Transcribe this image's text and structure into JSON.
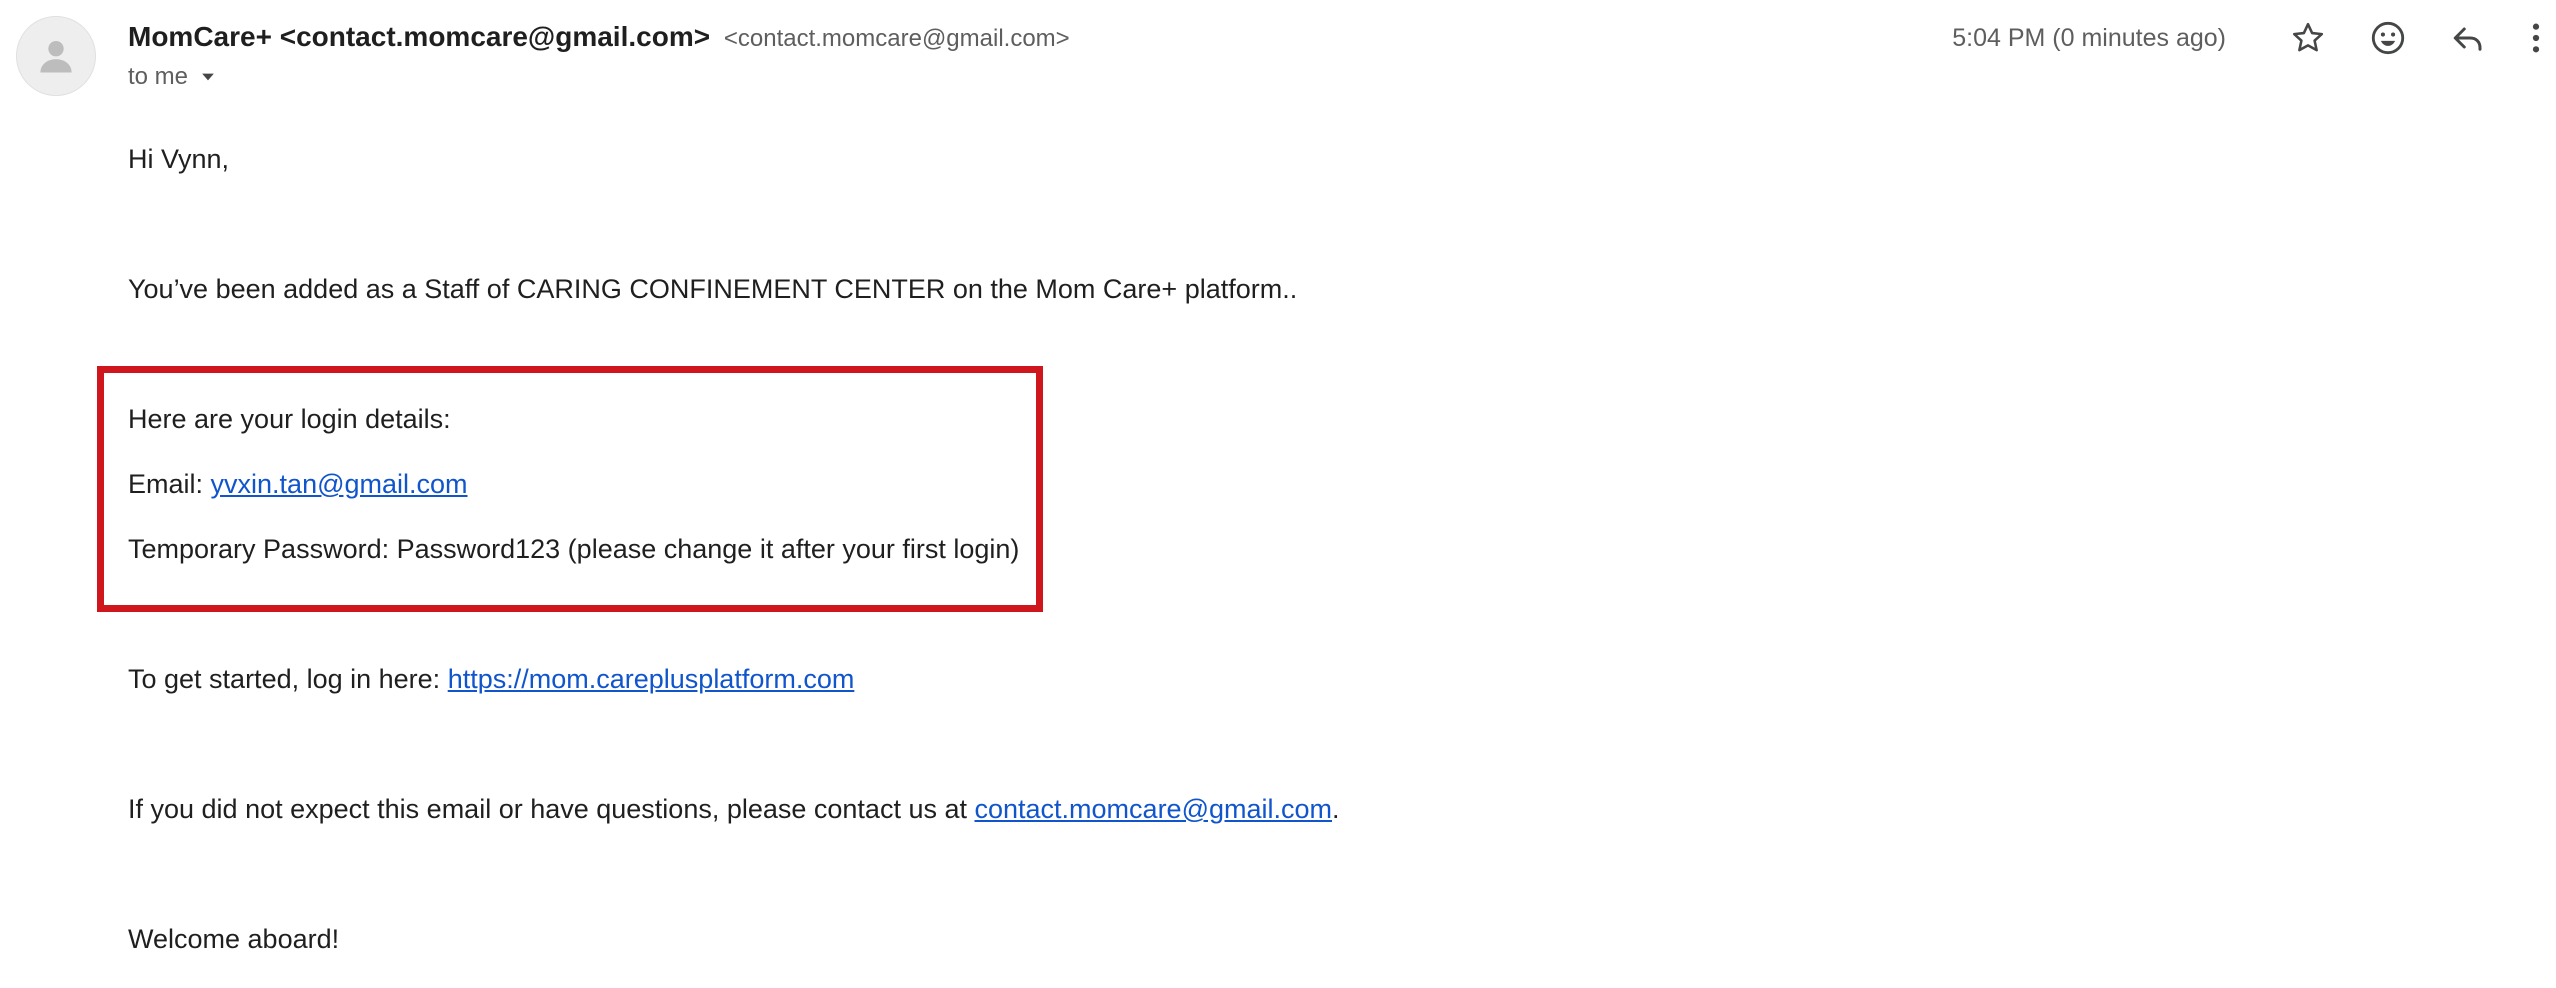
{
  "header": {
    "sender_name": "MomCare+ <contact.momcare@gmail.com>",
    "sender_email": "<contact.momcare@gmail.com>",
    "recipient": "to me",
    "timestamp": "5:04 PM (0 minutes ago)",
    "icons": [
      "person-icon",
      "chevron-down-icon",
      "star-icon",
      "emoji-icon",
      "reply-icon",
      "more-vert-icon"
    ]
  },
  "body": {
    "greeting": "Hi Vynn,",
    "intro": "You’ve been added as a Staff of CARING CONFINEMENT CENTER on the Mom Care+ platform..",
    "login_heading": "Here are your login details:",
    "email_label": "Email: ",
    "email_value": "yvxin.tan@gmail.com",
    "password_text": "Temporary Password: Password123 (please change it after your first login)",
    "start_label": "To get started, log in here: ",
    "start_link": "https://mom.careplusplatform.com",
    "contact_prefix": "If you did not expect this email or have questions, please contact us at ",
    "contact_link": "contact.momcare@gmail.com",
    "contact_suffix": ".",
    "closing": "Welcome aboard!"
  },
  "colors": {
    "highlight_border": "#d0161d",
    "link": "#1155cc",
    "text": "#1f1f1f",
    "muted": "#5e5e5e"
  }
}
